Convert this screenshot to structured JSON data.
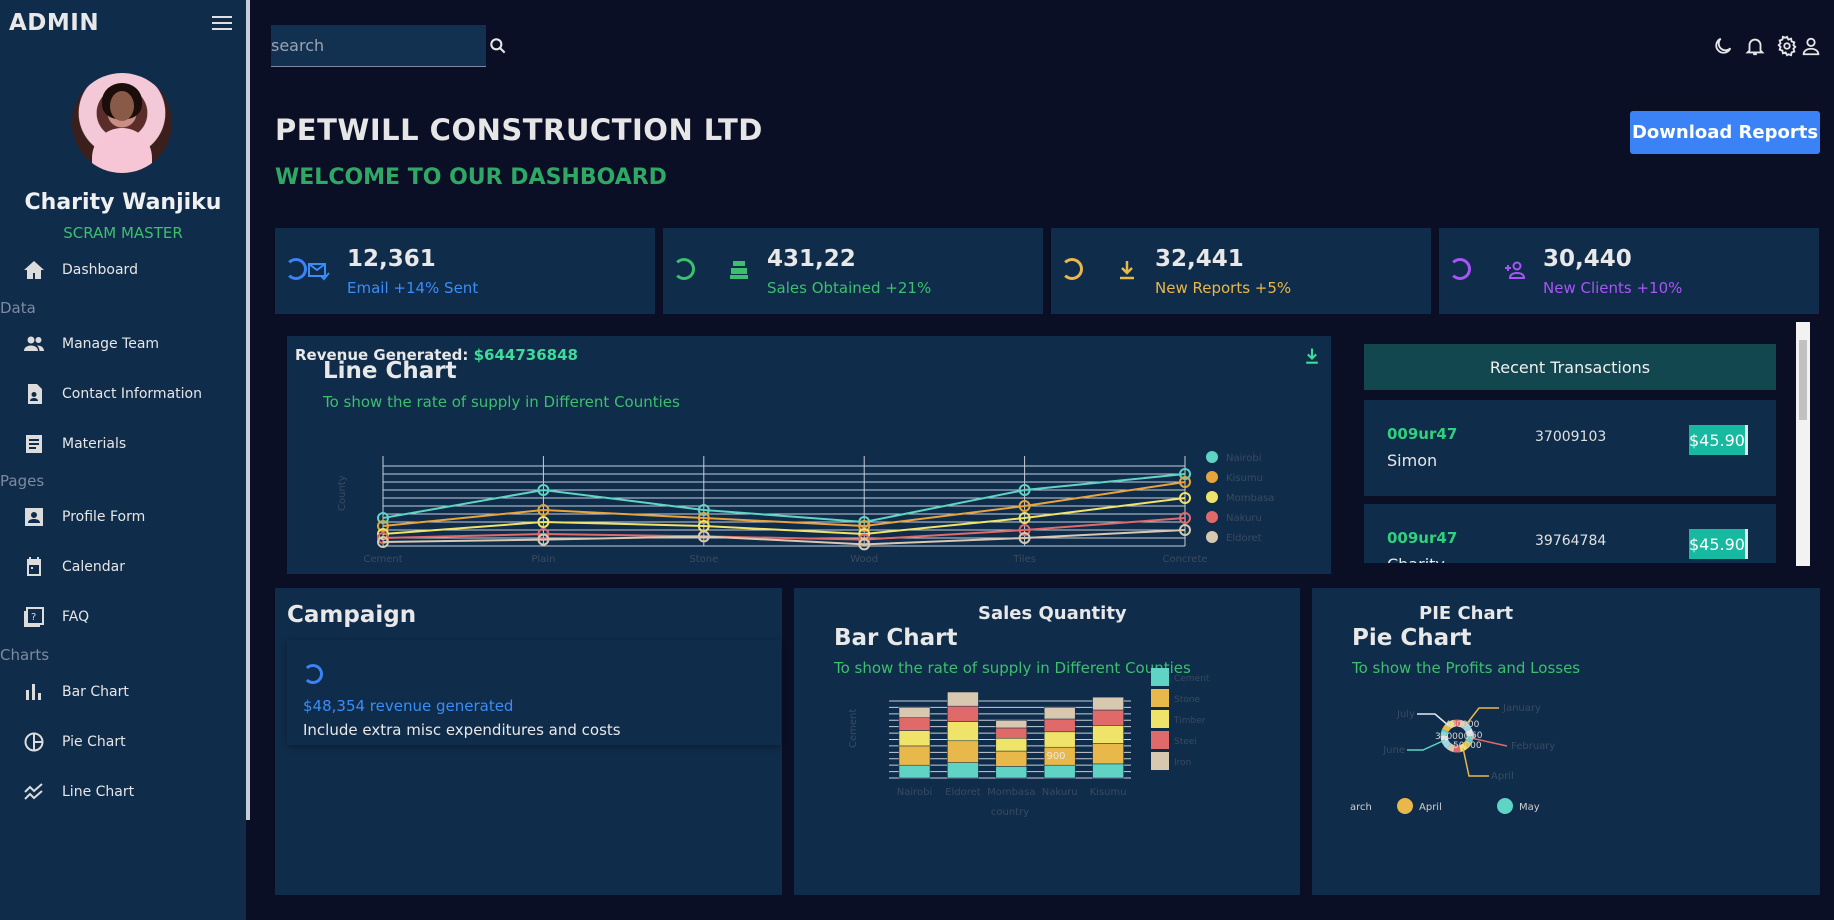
{
  "sidebar": {
    "brand": "ADMIN",
    "user": {
      "name": "Charity Wanjiku",
      "role": "SCRAM MASTER"
    },
    "items": [
      {
        "label": "Dashboard"
      },
      {
        "section": "Data"
      },
      {
        "label": "Manage Team"
      },
      {
        "label": "Contact Information"
      },
      {
        "label": "Materials"
      },
      {
        "section": "Pages"
      },
      {
        "label": "Profile Form"
      },
      {
        "label": "Calendar"
      },
      {
        "label": "FAQ"
      },
      {
        "section": "Charts"
      },
      {
        "label": "Bar Chart"
      },
      {
        "label": "Pie Chart"
      },
      {
        "label": "Line Chart"
      }
    ]
  },
  "topbar": {
    "search_placeholder": "search"
  },
  "header": {
    "title": "PETWILL CONSTRUCTION LTD",
    "subtitle": "WELCOME TO OUR DASHBOARD",
    "download_label": "Download Reports"
  },
  "stats": [
    {
      "value": "12,361",
      "label": "Email +14% Sent",
      "color": "#3b8df6"
    },
    {
      "value": "431,22",
      "label": "Sales Obtained +21%",
      "color": "#3dbf6e"
    },
    {
      "value": "32,441",
      "label": "New Reports +5%",
      "color": "#e8b84a"
    },
    {
      "value": "30,440",
      "label": "New Clients +10%",
      "color": "#a855f7"
    }
  ],
  "revenue": {
    "label": "Revenue Generated: ",
    "value": "$644736848"
  },
  "line_panel": {
    "title": "Line Chart",
    "subtitle": "To show the rate of supply in Different Counties"
  },
  "transactions": {
    "title": "Recent Transactions",
    "rows": [
      {
        "id": "009ur47",
        "user": "Simon",
        "date": "37009103",
        "cost": "$45.90"
      },
      {
        "id": "009ur47",
        "user": "Charity",
        "date": "39764784",
        "cost": "$45.90"
      }
    ]
  },
  "campaign": {
    "title": "Campaign",
    "revenue": "$48,354 revenue generated",
    "note": "Include extra misc expenditures and costs"
  },
  "sales_panel": {
    "heading": "Sales Quantity",
    "title": "Bar Chart",
    "subtitle": "To show the rate of supply in Different Counties"
  },
  "pie_panel": {
    "heading": "PIE Chart",
    "title": "Pie Chart",
    "subtitle": "To show the Profits and Losses"
  },
  "chart_data": [
    {
      "type": "line",
      "categories": [
        "Cement",
        "Plain",
        "Stone",
        "Wood",
        "Tiles",
        "Concrete"
      ],
      "ylabel": "County",
      "series": [
        {
          "name": "Nairobi",
          "color": "#5fd3c4",
          "values": [
            350,
            700,
            450,
            300,
            700,
            900
          ]
        },
        {
          "name": "Kisumu",
          "color": "#e8a33a",
          "values": [
            250,
            450,
            350,
            250,
            500,
            800
          ]
        },
        {
          "name": "Mombasa",
          "color": "#f0e36a",
          "values": [
            150,
            300,
            250,
            150,
            350,
            600
          ]
        },
        {
          "name": "Nakuru",
          "color": "#e06a6a",
          "values": [
            100,
            150,
            120,
            80,
            200,
            350
          ]
        },
        {
          "name": "Eldoret",
          "color": "#d8c8b0",
          "values": [
            50,
            80,
            120,
            20,
            100,
            200
          ]
        }
      ]
    },
    {
      "type": "bar",
      "categories": [
        "Nairobi",
        "Eldoret",
        "Mombasa",
        "Nakuru",
        "Kisumu"
      ],
      "xlabel": "country",
      "ylabel": "Cement",
      "legend": [
        "Cement",
        "Stone",
        "Timber",
        "Steel",
        "Iron"
      ],
      "colors": [
        "#5fd3c4",
        "#e8b84a",
        "#f0e36a",
        "#e06a6a",
        "#d8c8b0"
      ],
      "series": [
        {
          "name": "Cement",
          "values": [
            100,
            120,
            90,
            100,
            110
          ]
        },
        {
          "name": "Stone",
          "values": [
            150,
            170,
            120,
            140,
            160
          ]
        },
        {
          "name": "Timber",
          "values": [
            120,
            150,
            100,
            120,
            140
          ]
        },
        {
          "name": "Steel",
          "values": [
            100,
            120,
            80,
            100,
            120
          ]
        },
        {
          "name": "Iron",
          "values": [
            80,
            110,
            60,
            90,
            100
          ]
        }
      ],
      "annotation": "900"
    },
    {
      "type": "pie",
      "labels": [
        "January",
        "February",
        "April",
        "June",
        "July"
      ],
      "inner_labels": [
        "480000",
        "3800000",
        "60",
        "50000"
      ],
      "legend": [
        "arch",
        "April",
        "May"
      ],
      "legend_colors": [
        "#e8e8e8",
        "#e8b84a",
        "#5fd3c4"
      ]
    }
  ]
}
